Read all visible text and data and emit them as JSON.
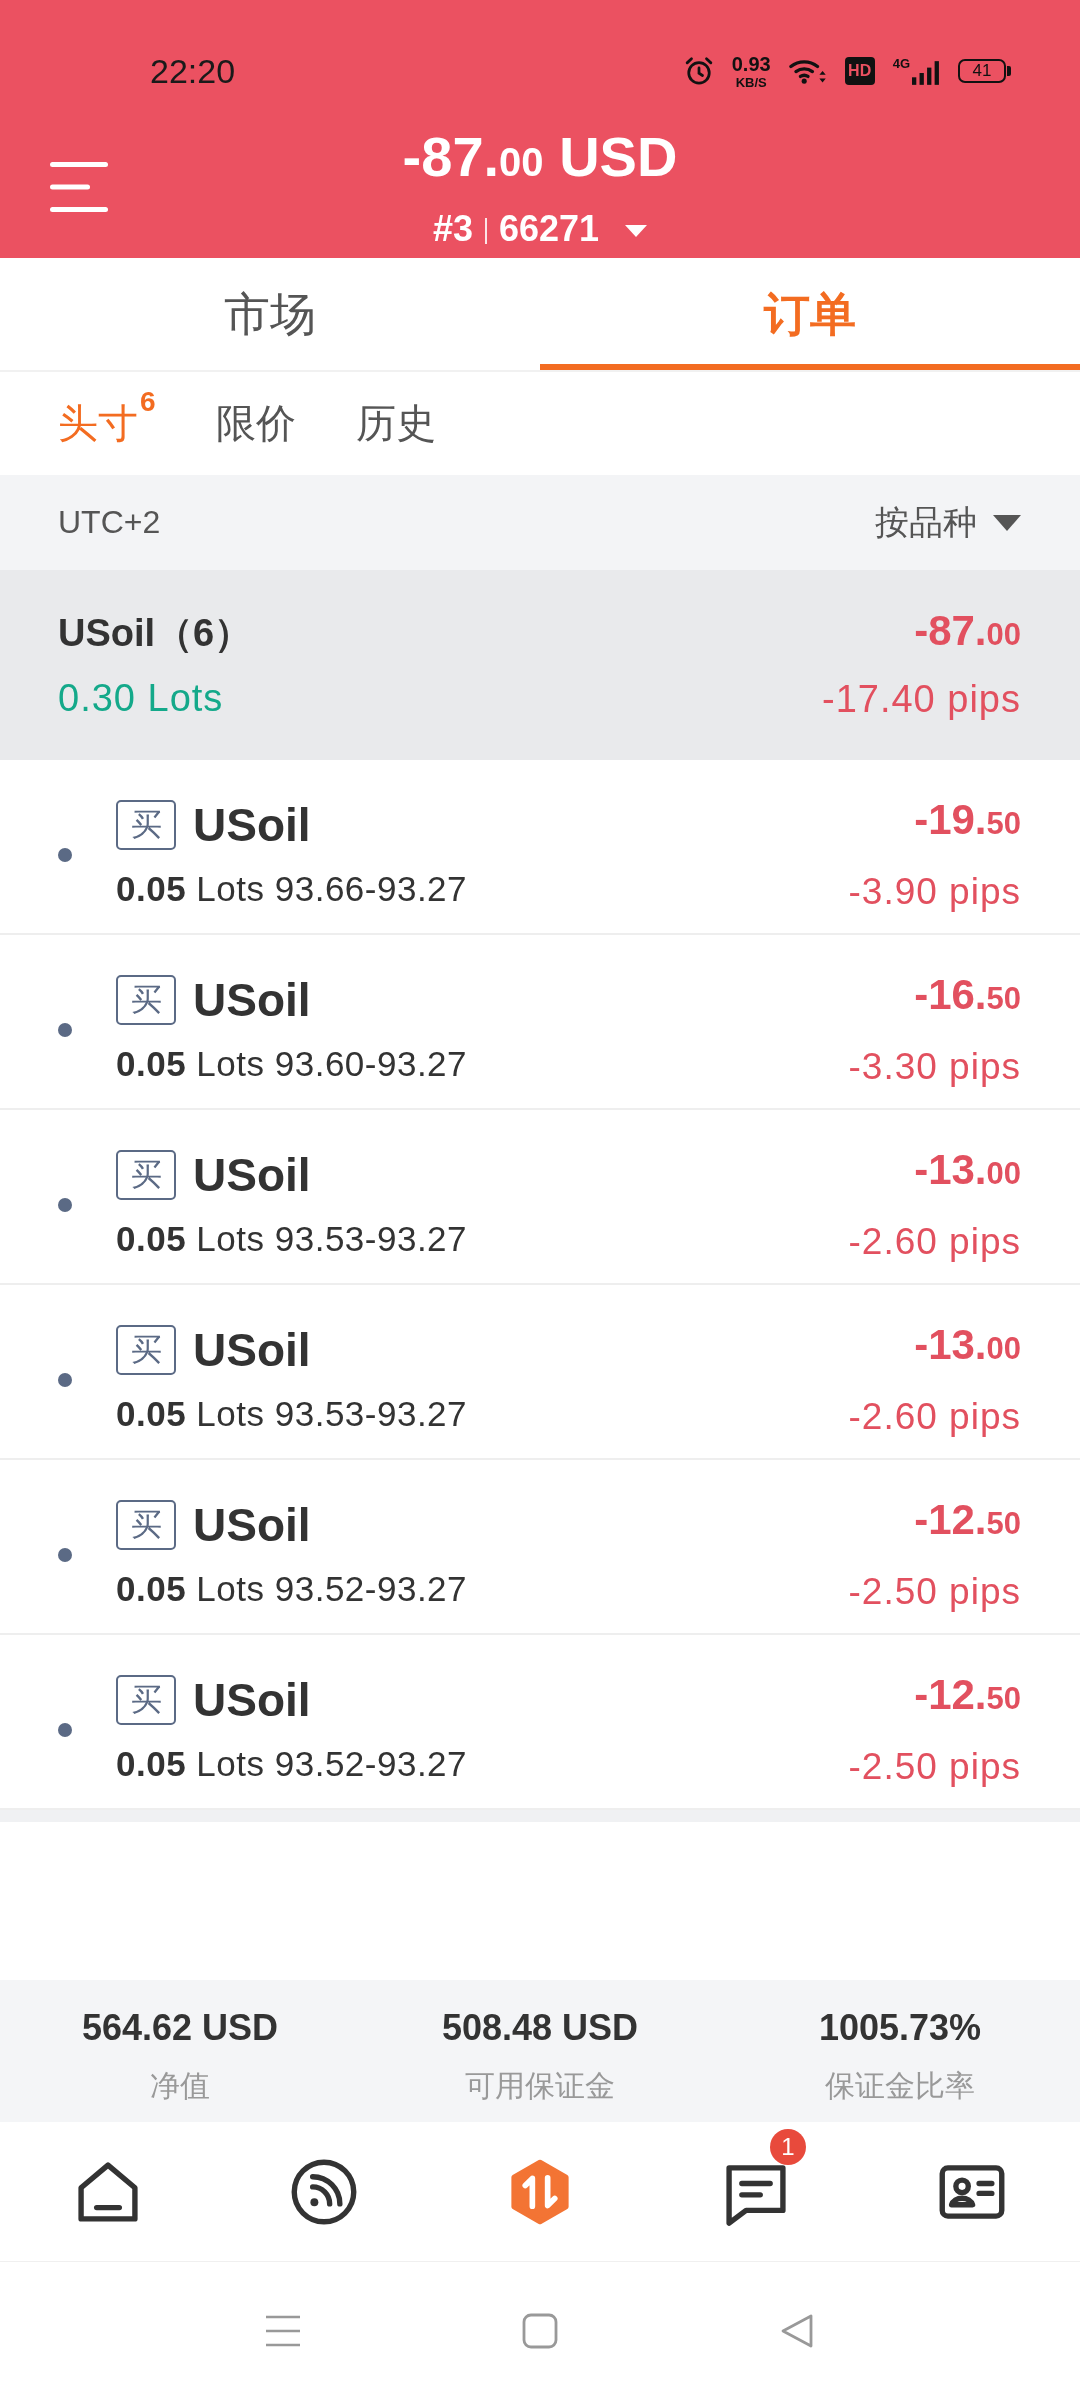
{
  "status_bar": {
    "time": "22:20",
    "net_speed": "0.93",
    "net_speed_unit": "KB/S",
    "hd_label": "HD",
    "network_type": "4G",
    "battery": "41"
  },
  "header": {
    "balance_main": "-87.",
    "balance_cents": "00",
    "currency": "USD",
    "account_number": "#3",
    "account_login": "66271"
  },
  "tabs": [
    {
      "label": "市场",
      "selected": false
    },
    {
      "label": "订单",
      "selected": true
    }
  ],
  "subtabs": [
    {
      "label": "头寸",
      "count": "6",
      "selected": true
    },
    {
      "label": "限价",
      "selected": false
    },
    {
      "label": "历史",
      "selected": false
    }
  ],
  "filter_bar": {
    "timezone": "UTC+2",
    "sort_label": "按品种"
  },
  "group": {
    "name": "USoil（6）",
    "lots": "0.30 Lots",
    "profit_main": "-87.",
    "profit_cents": "00",
    "pips": "-17.40 pips"
  },
  "orders": [
    {
      "side": "买",
      "symbol": "USoil",
      "details": "**0.05** Lots 93.66-93.27",
      "profit_main": "-19.",
      "profit_cents": "50",
      "pips": "-3.90 pips"
    },
    {
      "side": "买",
      "symbol": "USoil",
      "details": "**0.05** Lots 93.60-93.27",
      "profit_main": "-16.",
      "profit_cents": "50",
      "pips": "-3.30 pips"
    },
    {
      "side": "买",
      "symbol": "USoil",
      "details": "**0.05** Lots 93.53-93.27",
      "profit_main": "-13.",
      "profit_cents": "00",
      "pips": "-2.60 pips"
    },
    {
      "side": "买",
      "symbol": "USoil",
      "details": "**0.05** Lots 93.53-93.27",
      "profit_main": "-13.",
      "profit_cents": "00",
      "pips": "-2.60 pips"
    },
    {
      "side": "买",
      "symbol": "USoil",
      "details": "**0.05** Lots 93.52-93.27",
      "profit_main": "-12.",
      "profit_cents": "50",
      "pips": "-2.50 pips"
    },
    {
      "side": "买",
      "symbol": "USoil",
      "details": "**0.05** Lots 93.52-93.27",
      "profit_main": "-12.",
      "profit_cents": "50",
      "pips": "-2.50 pips"
    }
  ],
  "summary": [
    {
      "value": "564.62 USD",
      "label": "净值"
    },
    {
      "value": "508.48 USD",
      "label": "可用保证金"
    },
    {
      "value": "1005.73%",
      "label": "保证金比率"
    }
  ],
  "bottom_nav": [
    {
      "selected": false
    },
    {
      "selected": false
    },
    {
      "selected": true
    },
    {
      "selected": false,
      "badge": "1"
    },
    {
      "selected": false
    }
  ]
}
